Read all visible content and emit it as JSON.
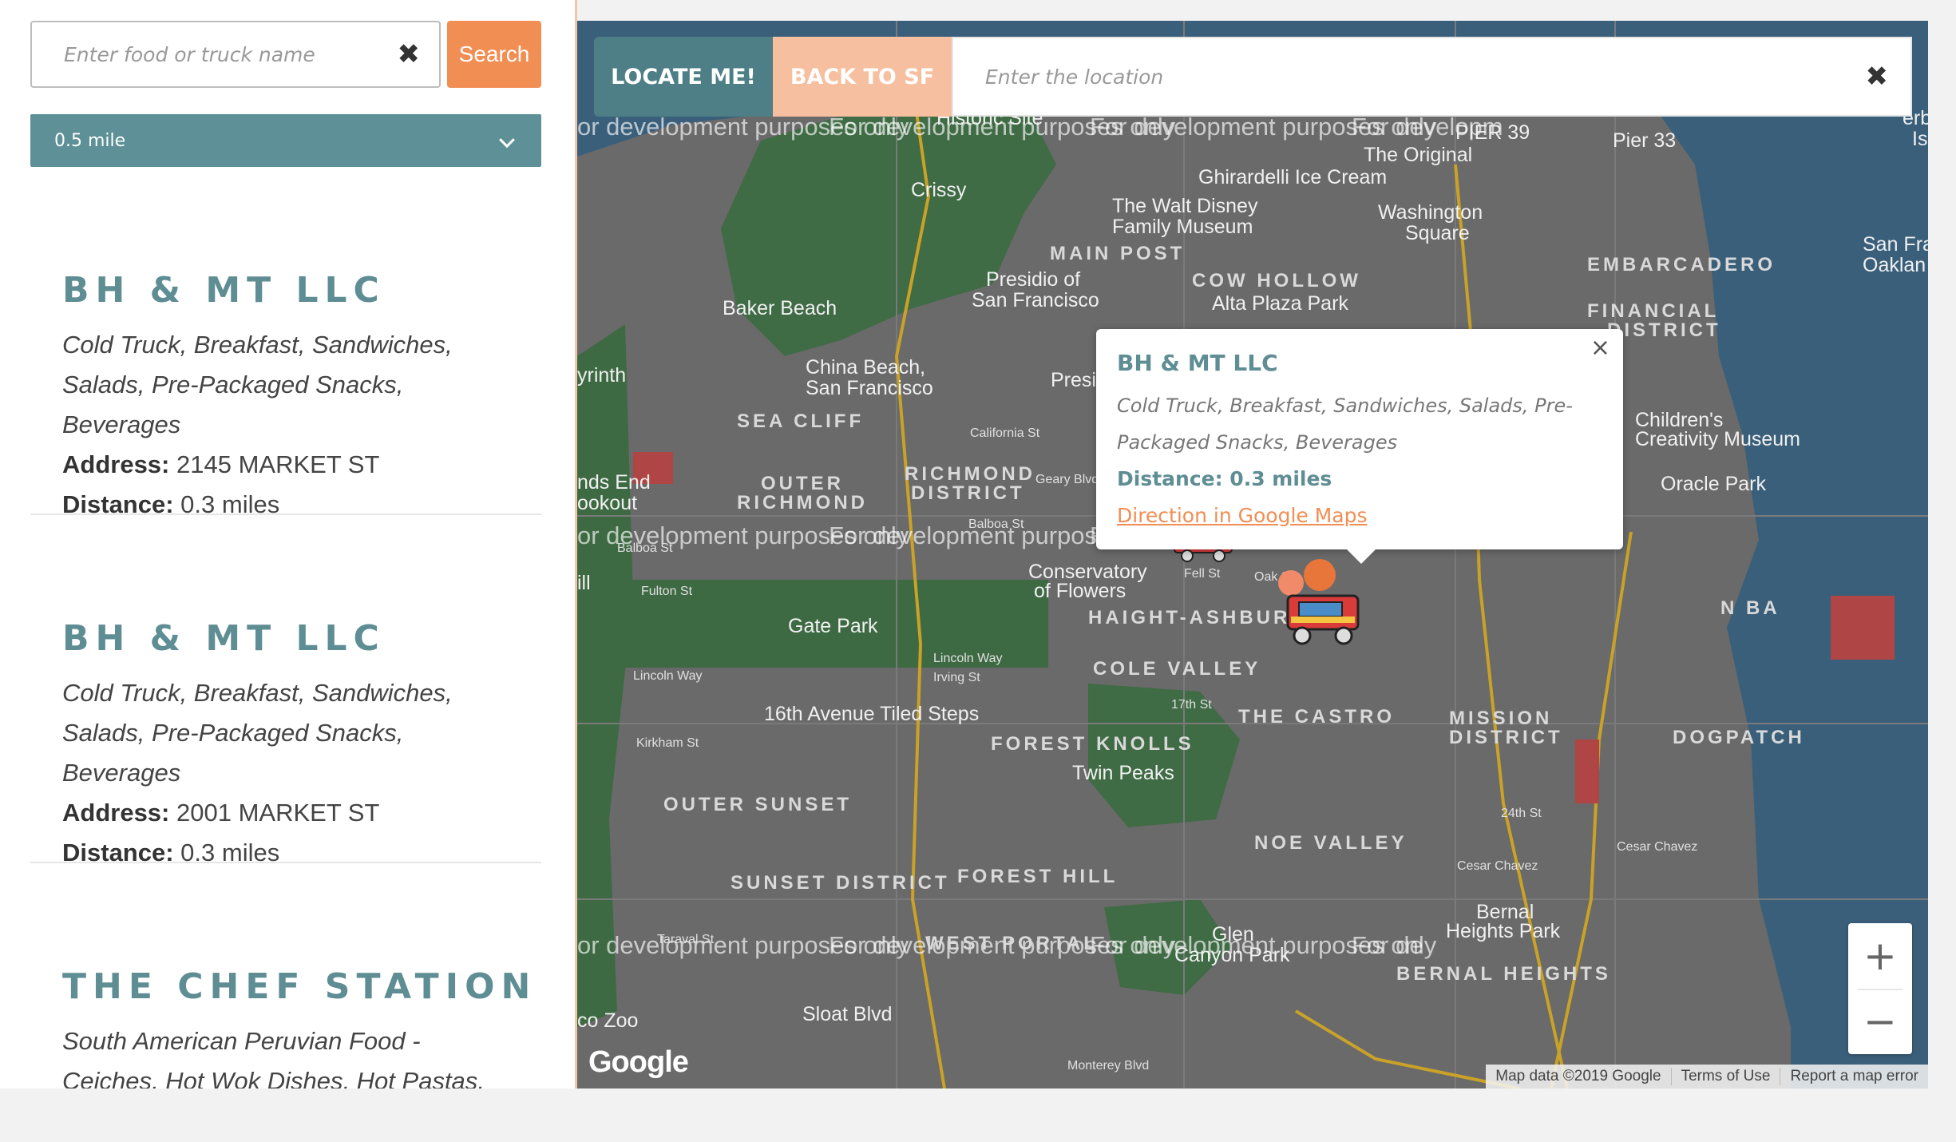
{
  "search": {
    "placeholder": "Enter food or truck name",
    "clear_icon": "close-icon",
    "button_label": "Search"
  },
  "distance_filter": {
    "selected": "0.5 mile"
  },
  "trucks": [
    {
      "name": "BH & MT LLC",
      "categories": "Cold Truck, Breakfast, Sandwiches, Salads, Pre-Packaged Snacks, Beverages",
      "address_label": "Address:",
      "address": "2145 MARKET ST",
      "distance_label": "Distance:",
      "distance": "0.3 miles"
    },
    {
      "name": "BH & MT LLC",
      "categories": "Cold Truck, Breakfast, Sandwiches, Salads, Pre-Packaged Snacks, Beverages",
      "address_label": "Address:",
      "address": "2001 MARKET ST",
      "distance_label": "Distance:",
      "distance": "0.3 miles"
    },
    {
      "name": "THE CHEF STATION",
      "categories": "South American Peruvian Food - Ceiches, Hot Wok Dishes, Hot Pastas, Rice Dishes, And"
    }
  ],
  "map": {
    "locate_label": "LOCATE ME!",
    "back_label": "BACK TO SF",
    "location_placeholder": "Enter the location",
    "watermark": "For development purposes only",
    "watermark_left": "or development purposes only",
    "watermark_right": "For developm",
    "watermark_bottom_right": "For de",
    "popup": {
      "title": "BH & MT LLC",
      "categories": "Cold Truck, Breakfast, Sandwiches, Salads, Pre-Packaged Snacks, Beverages",
      "distance": "Distance: 0.3 miles",
      "link": "Direction in Google Maps"
    },
    "labels": {
      "historic": "Historic Site",
      "pier39": "PIER 39",
      "pier33": "Pier 33",
      "original": "The Original",
      "icecream": "Ghirardelli Ice Cream",
      "crissy": "Crissy",
      "waltdisney": "The Walt Disney",
      "familymuseum": "Family Museum",
      "washington": "Washington",
      "square": "Square",
      "mainpost": "MAIN POST",
      "cowhollow": "COW HOLLOW",
      "embarcadero": "EMBARCADERO",
      "presidio": "Presidio of",
      "sanfrancisco": "San Francisco",
      "alta": "Alta Plaza Park",
      "financial": "FINANCIAL",
      "district": "DISTRICT",
      "baker": "Baker Beach",
      "chinabeach": "China Beach,",
      "chinasf": "San Francisco",
      "presidi": "Presidi",
      "labyrinth": "yrinth",
      "seacliff": "SEA CLIFF",
      "childrens": "Children's",
      "creativity": "Creativity Museum",
      "oracle": "Oracle Park",
      "landsend": "nds End",
      "lookout": "ookout",
      "outer": "OUTER",
      "richmond": "RICHMOND",
      "richmond2": "RICHMOND",
      "district2": "DISTRICT",
      "conservatory": "Conservatory",
      "offlowers": "of Flowers",
      "haight": "HAIGHT-ASHBURY",
      "gatepark": "Gate Park",
      "colevalley": "COLE VALLEY",
      "sixteenth": "16th Avenue Tiled Steps",
      "castro": "THE CASTRO",
      "mission": "MISSION",
      "missiond": "DISTRICT",
      "dogpatch": "DOGPATCH",
      "forestknolls": "FOREST KNOLLS",
      "twinpeaks": "Twin Peaks",
      "outersunset": "OUTER SUNSET",
      "noevalley": "NOE VALLEY",
      "sunset": "SUNSET DISTRICT",
      "foresthill": "FOREST HILL",
      "westportal": "WEST PORTAL",
      "glen": "Glen",
      "canyon": "Canyon Park",
      "bernal": "Bernal",
      "heights": "Heights Park",
      "bernalheights": "BERNAL HEIGHTS",
      "sloat": "Sloat Blvd",
      "zoo": "co Zoo",
      "sanfra": "San Fra",
      "oaklan": "Oaklan",
      "hill": "ill",
      "erb": "erb",
      "is": "Is",
      "baytext": "N BA"
    },
    "streets": {
      "california": "California St",
      "geary": "Geary Blvd",
      "balboa": "Balboa St",
      "balboa2": "Balboa St",
      "fulton": "Fulton St",
      "lincoln": "Lincoln Way",
      "lincoln2": "Lincoln Way",
      "irving": "Irving St",
      "kirkham": "Kirkham St",
      "taraval": "Taraval St",
      "seventeenth": "17th St",
      "twentyfourth": "24th St",
      "cesar": "Cesar Chavez",
      "cesar2": "Cesar Chavez",
      "monterey": "Monterey Blvd",
      "fell": "Fell St",
      "oak": "Oak St"
    },
    "google": "Google",
    "attribution": {
      "data": "Map data ©2019 Google",
      "terms": "Terms of Use",
      "report": "Report a map error"
    },
    "zoom_in_icon": "plus-icon",
    "zoom_out_icon": "minus-icon"
  }
}
